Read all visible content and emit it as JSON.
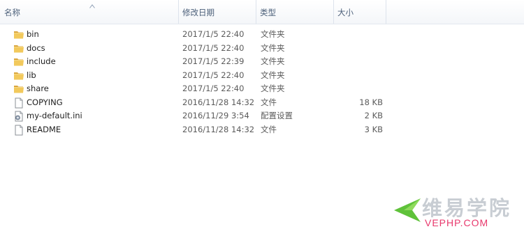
{
  "columns": {
    "name": "名称",
    "date": "修改日期",
    "type": "类型",
    "size": "大小"
  },
  "files": [
    {
      "name": "bin",
      "date": "2017/1/5 22:40",
      "type": "文件夹",
      "size": "",
      "icon": "folder-icon"
    },
    {
      "name": "docs",
      "date": "2017/1/5 22:40",
      "type": "文件夹",
      "size": "",
      "icon": "folder-icon"
    },
    {
      "name": "include",
      "date": "2017/1/5 22:39",
      "type": "文件夹",
      "size": "",
      "icon": "folder-icon"
    },
    {
      "name": "lib",
      "date": "2017/1/5 22:40",
      "type": "文件夹",
      "size": "",
      "icon": "folder-icon"
    },
    {
      "name": "share",
      "date": "2017/1/5 22:40",
      "type": "文件夹",
      "size": "",
      "icon": "folder-icon"
    },
    {
      "name": "COPYING",
      "date": "2016/11/28 14:32",
      "type": "文件",
      "size": "18 KB",
      "icon": "file-icon"
    },
    {
      "name": "my-default.ini",
      "date": "2016/11/29 3:54",
      "type": "配置设置",
      "size": "2 KB",
      "icon": "ini-settings-icon"
    },
    {
      "name": "README",
      "date": "2016/11/28 14:32",
      "type": "文件",
      "size": "3 KB",
      "icon": "file-icon"
    }
  ],
  "watermark": {
    "title": "维易学院",
    "subtitle": "VEPHP.COM"
  },
  "colors": {
    "folder": "#e8b84a",
    "header_text": "#4c607a",
    "watermark_green": "#5fc23a",
    "watermark_pink": "#e8386c"
  }
}
